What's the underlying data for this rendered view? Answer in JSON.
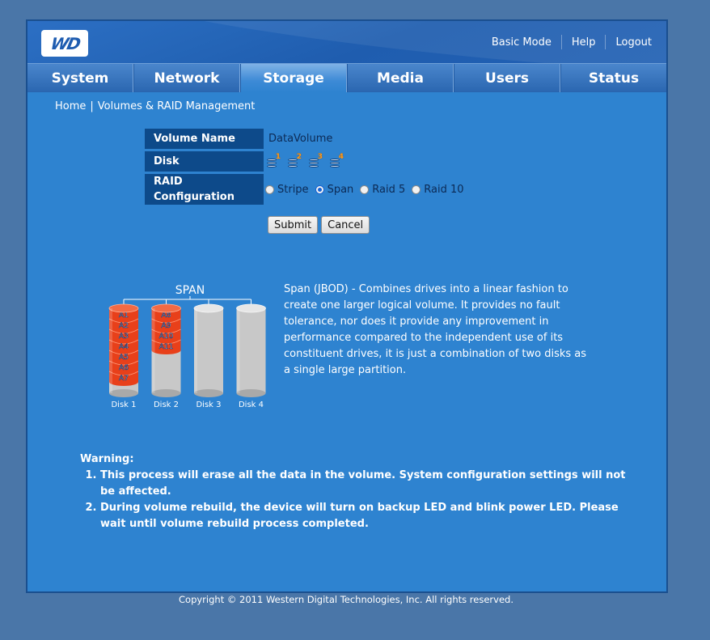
{
  "header": {
    "logo_text": "WD",
    "links": [
      "Basic Mode",
      "Help",
      "Logout"
    ]
  },
  "tabs": [
    {
      "label": "System",
      "active": false
    },
    {
      "label": "Network",
      "active": false
    },
    {
      "label": "Storage",
      "active": true
    },
    {
      "label": "Media",
      "active": false
    },
    {
      "label": "Users",
      "active": false
    },
    {
      "label": "Status",
      "active": false
    }
  ],
  "breadcrumb": {
    "home": "Home",
    "separator": "|",
    "current": "Volumes & RAID Management"
  },
  "form": {
    "volume_name_label": "Volume Name",
    "volume_name_value": "DataVolume",
    "disk_label": "Disk",
    "disks": [
      "1",
      "2",
      "3",
      "4"
    ],
    "raid_label_line1": "RAID",
    "raid_label_line2": "Configuration",
    "raid_options": [
      {
        "label": "Stripe",
        "checked": false
      },
      {
        "label": "Span",
        "checked": true
      },
      {
        "label": "Raid 5",
        "checked": false
      },
      {
        "label": "Raid 10",
        "checked": false
      }
    ],
    "submit_label": "Submit",
    "cancel_label": "Cancel"
  },
  "diagram": {
    "title": "SPAN",
    "disks": [
      {
        "label": "Disk 1",
        "blocks": [
          "A1",
          "A2",
          "A3",
          "A4",
          "A5",
          "A6",
          "A7"
        ]
      },
      {
        "label": "Disk 2",
        "blocks": [
          "A8",
          "A9",
          "A10",
          "A11"
        ]
      },
      {
        "label": "Disk 3",
        "blocks": []
      },
      {
        "label": "Disk 4",
        "blocks": []
      }
    ],
    "colors": {
      "used": "#e8401a",
      "empty": "#c8c8c8"
    }
  },
  "description": "Span (JBOD) - Combines drives into a linear fashion to create one larger logical volume. It provides no fault tolerance, nor does it provide any improvement in performance compared to the independent use of its constituent drives, it is just a combination of two disks as a single large partition.",
  "warning": {
    "title": "Warning:",
    "items": [
      "This process will erase all the data in the volume. System configuration settings will not be affected.",
      "During volume rebuild, the device will turn on backup LED and blink power LED. Please wait until volume rebuild process completed."
    ]
  },
  "footer": {
    "copyright": "Copyright © 2011 Western Digital Technologies, Inc. All rights reserved."
  }
}
